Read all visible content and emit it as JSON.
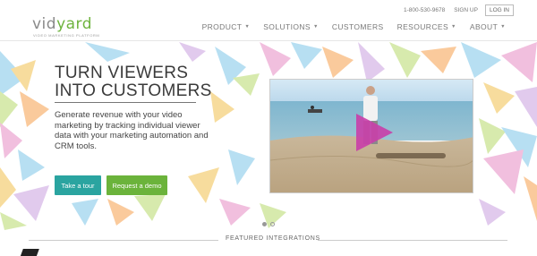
{
  "header": {
    "logo_part1": "vid",
    "logo_part2": "yard",
    "logo_tagline": "video marketing platform",
    "phone": "1-800-530-9678",
    "signup": "SIGN UP",
    "login": "LOG IN",
    "nav": [
      {
        "label": "PRODUCT",
        "has_caret": true
      },
      {
        "label": "SOLUTIONS",
        "has_caret": true
      },
      {
        "label": "CUSTOMERS",
        "has_caret": false
      },
      {
        "label": "RESOURCES",
        "has_caret": true
      },
      {
        "label": "ABOUT",
        "has_caret": true
      }
    ],
    "caret_glyph": "▼"
  },
  "hero": {
    "headline_line1": "TURN VIEWERS",
    "headline_line2": "INTO CUSTOMERS",
    "subtext": "Generate revenue with your video marketing by tracking individual viewer data with your marketing automation and CRM tools.",
    "btn_tour": "Take a tour",
    "btn_demo": "Request a demo",
    "video_play_icon": "play-icon"
  },
  "carousel": {
    "count": 2,
    "active": 1
  },
  "featured": {
    "label": "FEATURED INTEGRATIONS"
  },
  "colors": {
    "teal": "#2aa4a0",
    "green": "#6bb33b",
    "play_magenta": "#c93ea8"
  }
}
